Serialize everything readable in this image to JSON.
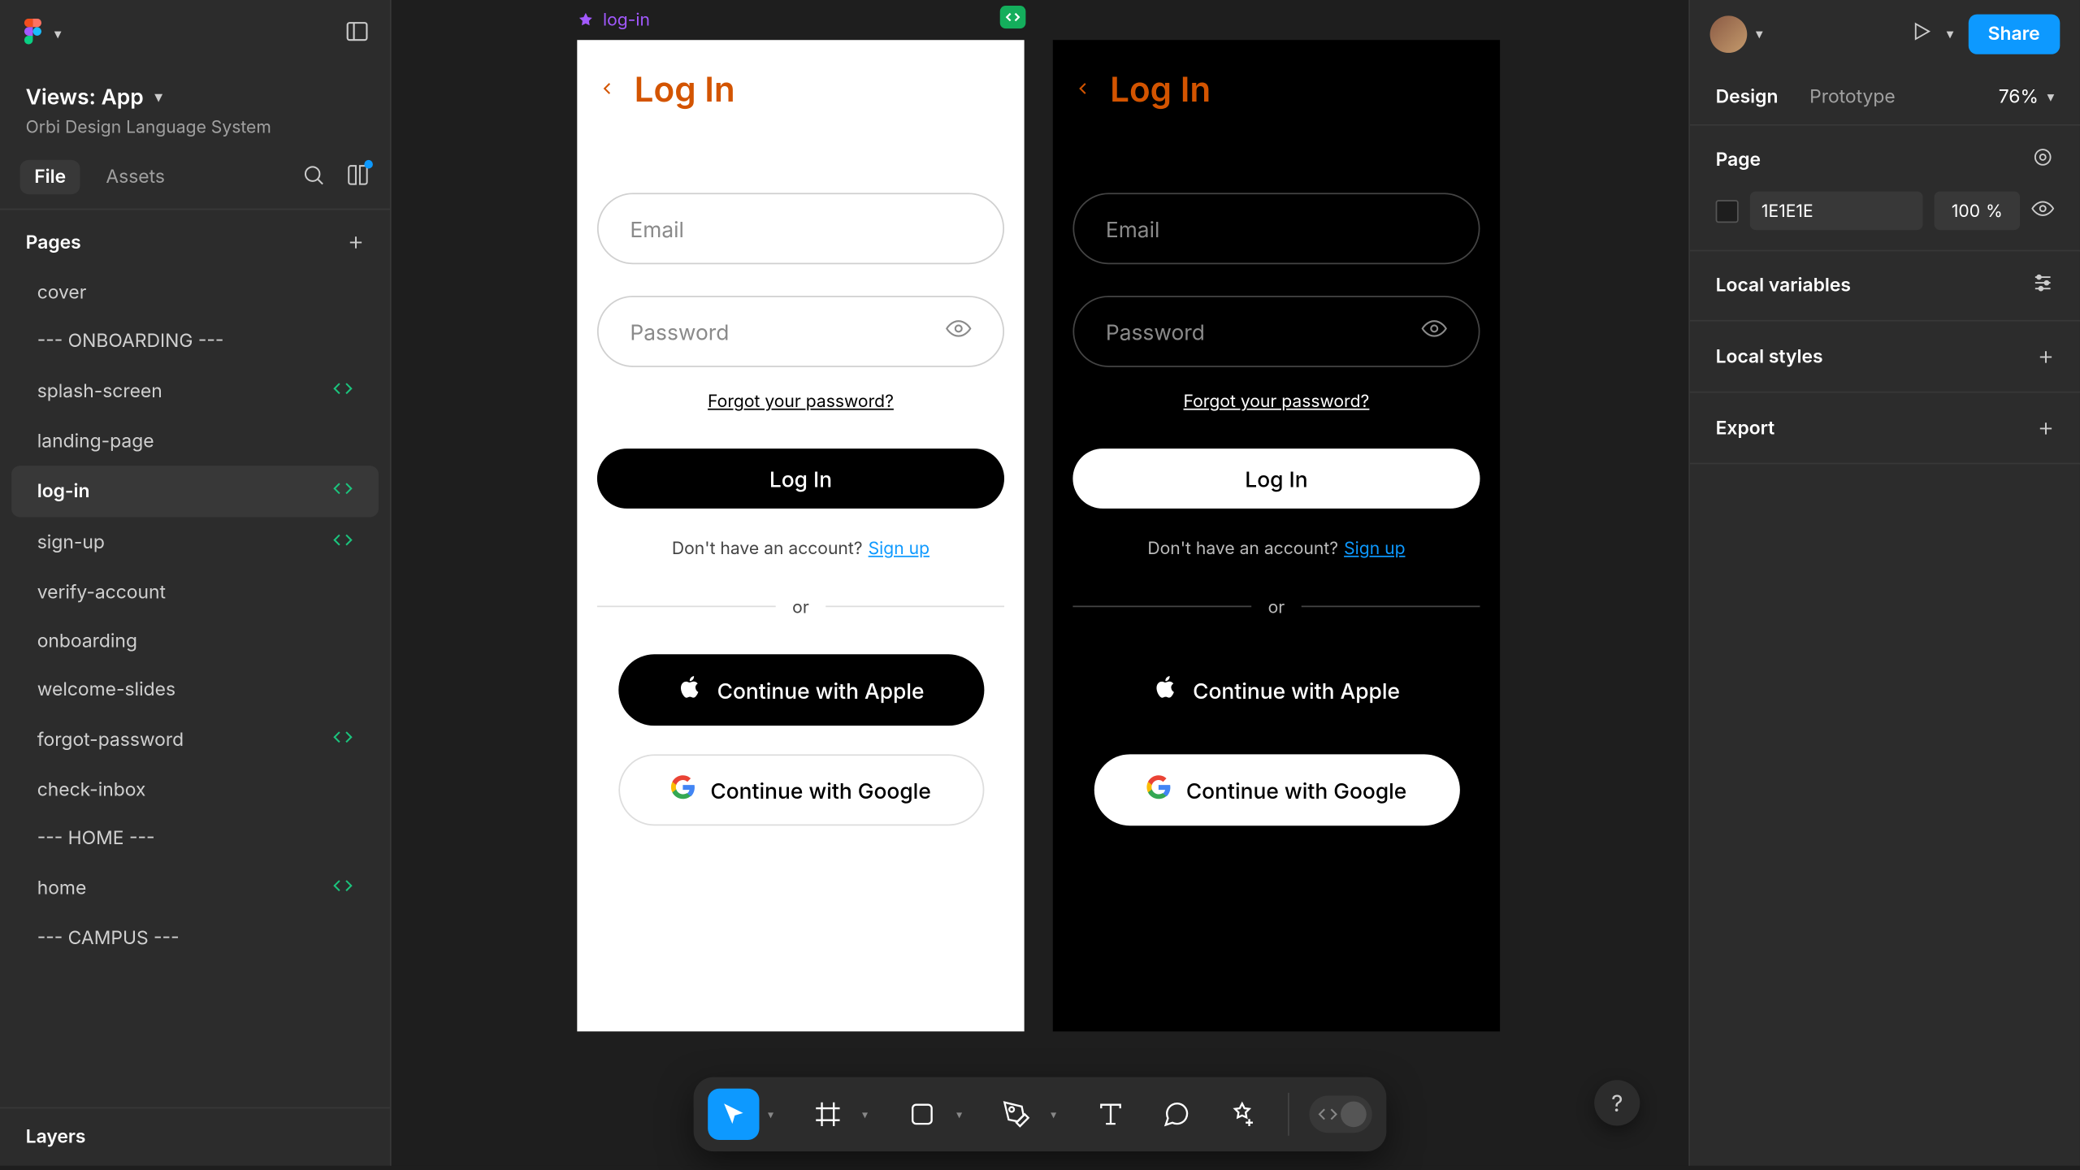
{
  "header": {
    "project_title": "Views: App",
    "project_subtitle": "Orbi Design Language System"
  },
  "left_tabs": {
    "file": "File",
    "assets": "Assets"
  },
  "pages_header": "Pages",
  "pages": [
    {
      "label": "cover",
      "rtp": false
    },
    {
      "label": "--- ONBOARDING ---",
      "rtp": false
    },
    {
      "label": "splash-screen",
      "rtp": true
    },
    {
      "label": "landing-page",
      "rtp": false
    },
    {
      "label": "log-in",
      "rtp": true,
      "selected": true
    },
    {
      "label": "sign-up",
      "rtp": true
    },
    {
      "label": "verify-account",
      "rtp": false
    },
    {
      "label": "onboarding",
      "rtp": false
    },
    {
      "label": "welcome-slides",
      "rtp": false
    },
    {
      "label": "forgot-password",
      "rtp": true
    },
    {
      "label": "check-inbox",
      "rtp": false
    },
    {
      "label": "--- HOME ---",
      "rtp": false
    },
    {
      "label": "home",
      "rtp": true
    },
    {
      "label": "--- CAMPUS ---",
      "rtp": false
    }
  ],
  "layers_label": "Layers",
  "canvas": {
    "frame_label": "log-in",
    "artboard": {
      "title": "Log In",
      "email_ph": "Email",
      "password_ph": "Password",
      "forgot": "Forgot your password?",
      "login_btn": "Log In",
      "no_account": "Don't have an account?",
      "signup": "Sign up",
      "or": "or",
      "apple": "Continue with Apple",
      "google": "Continue with Google"
    }
  },
  "right": {
    "share": "Share",
    "tab_design": "Design",
    "tab_prototype": "Prototype",
    "zoom": "76%",
    "page_section": "Page",
    "bg_hex": "1E1E1E",
    "bg_opacity": "100",
    "bg_opacity_unit": "%",
    "local_variables": "Local variables",
    "local_styles": "Local styles",
    "export": "Export"
  },
  "help": "?"
}
